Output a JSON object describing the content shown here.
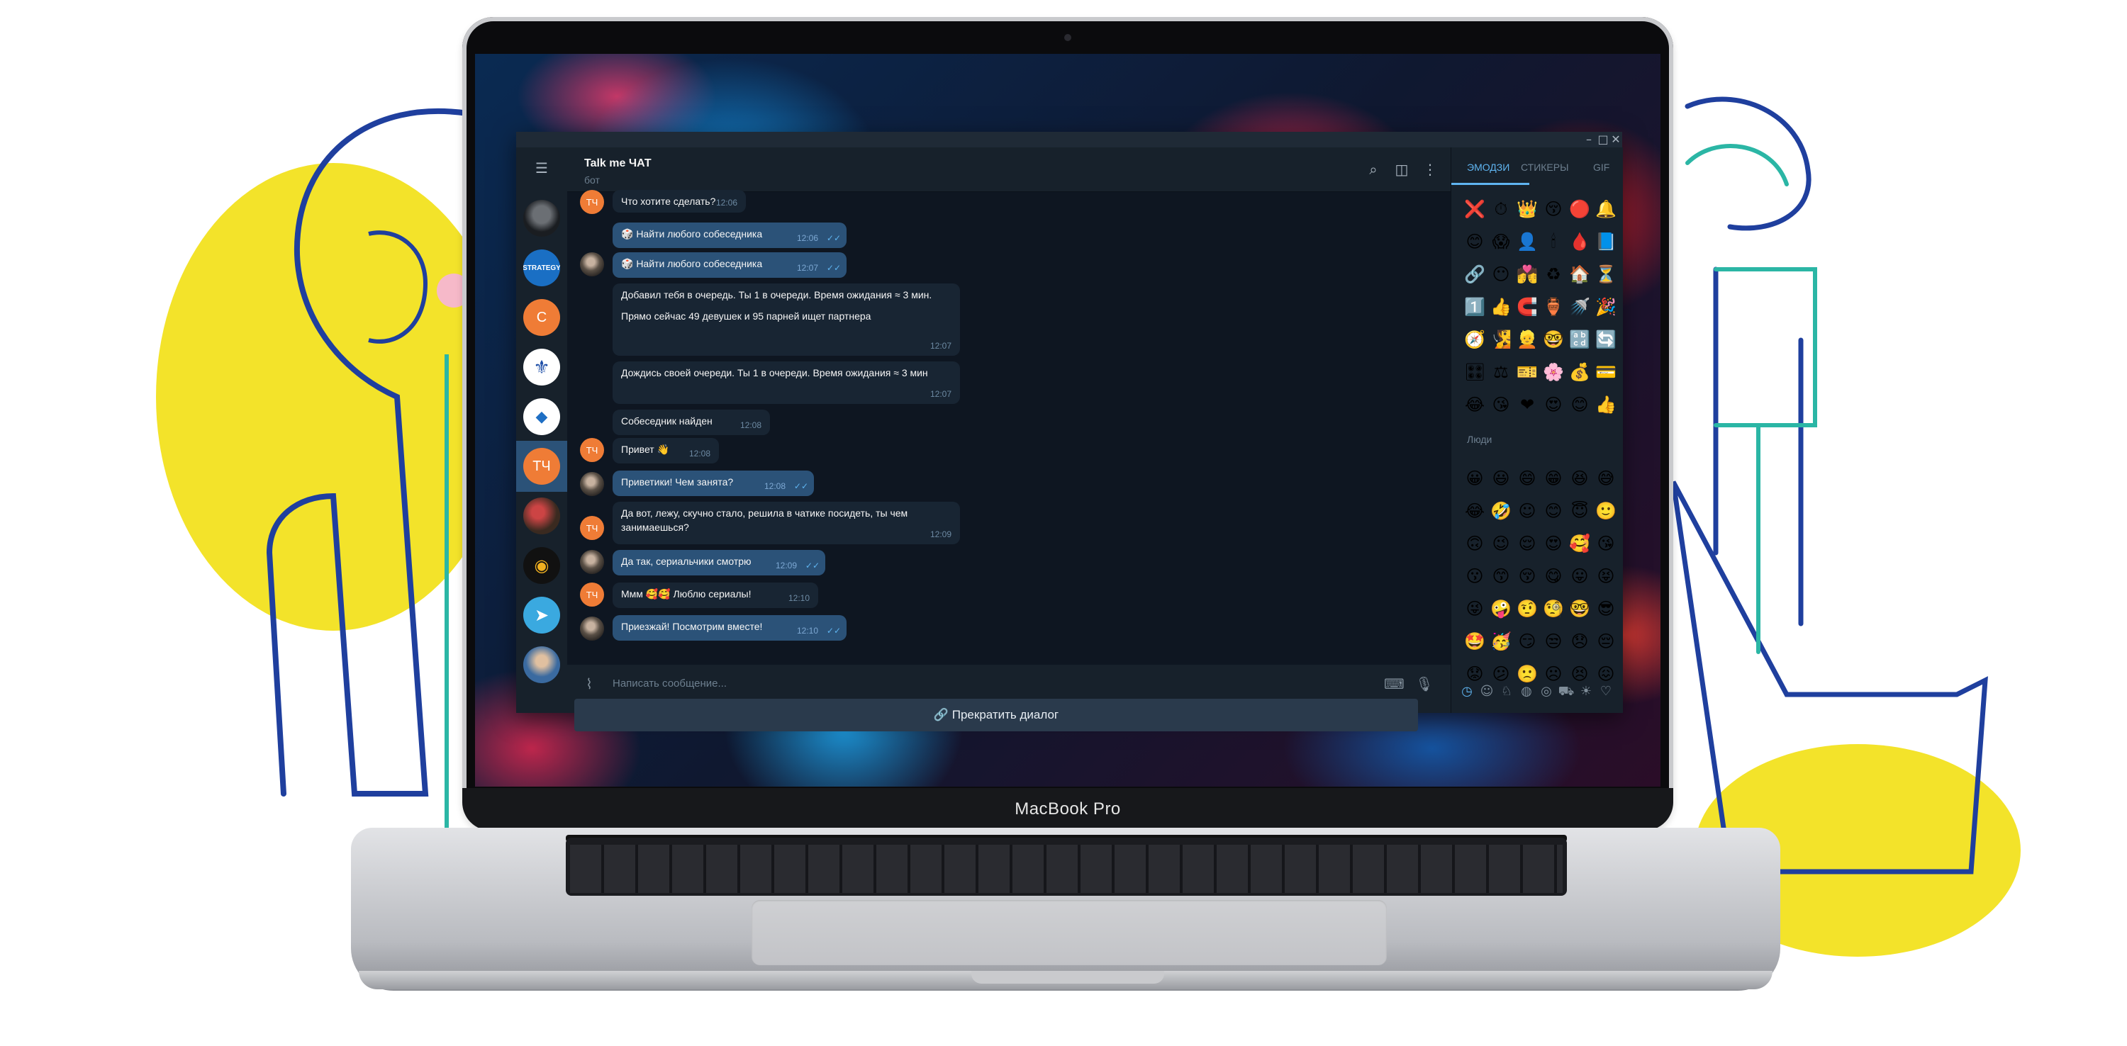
{
  "device": {
    "brand": "MacBook Pro"
  },
  "window": {
    "controls": [
      "minimize",
      "maximize",
      "close"
    ]
  },
  "sidebar": {
    "items": [
      {
        "name": "chat-1",
        "avatar": "photo-dark"
      },
      {
        "name": "chat-strategy",
        "avatar": "STRATEGY"
      },
      {
        "name": "chat-c",
        "initials": "С",
        "color": "#ef7c36"
      },
      {
        "name": "chat-4",
        "avatar": "blue-emblem"
      },
      {
        "name": "chat-5",
        "avatar": "fish-logo"
      },
      {
        "name": "chat-tc",
        "initials": "ТЧ",
        "color": "#ef7c36",
        "active": true
      },
      {
        "name": "chat-7",
        "avatar": "photo-game"
      },
      {
        "name": "chat-8",
        "avatar": "eye-logo"
      },
      {
        "name": "chat-telegram",
        "avatar": "telegram-plane"
      },
      {
        "name": "chat-10",
        "avatar": "photo-person"
      }
    ]
  },
  "chat": {
    "title": "Talk me ЧАТ",
    "subtitle": "бот",
    "messages": [
      {
        "dir": "in",
        "avatar": "ТЧ",
        "text": "Что хотите сделать?",
        "time": "12:06"
      },
      {
        "dir": "out",
        "text": "🎲 Найти любого собеседника",
        "time": "12:06",
        "read": true
      },
      {
        "dir": "out",
        "avatar": "photo",
        "text": "🎲 Найти любого собеседника",
        "time": "12:07",
        "read": true
      },
      {
        "dir": "in",
        "text": "Добавил тебя в очередь. Ты 1 в очереди. Время ожидания ≈ 3 мин.",
        "text2": "Прямо сейчас 49 девушек и 95 парней ищет партнера",
        "time": "12:07"
      },
      {
        "dir": "in",
        "text": "Дождись своей очереди. Ты 1 в очереди. Время ожидания ≈ 3 мин",
        "time": "12:07"
      },
      {
        "dir": "in",
        "text": "Собеседник найден",
        "time": "12:08"
      },
      {
        "dir": "in",
        "avatar": "ТЧ",
        "text": "Привет 👋",
        "time": "12:08"
      },
      {
        "dir": "out",
        "avatar": "photo",
        "text": "Приветики! Чем занята?",
        "time": "12:08",
        "read": true
      },
      {
        "dir": "in",
        "avatar": "ТЧ",
        "text": "Да вот, лежу, скучно стало, решила в чатике посидеть, ты чем занимаешься?",
        "time": "12:09"
      },
      {
        "dir": "out",
        "avatar": "photo",
        "text": "Да так, сериальчики смотрю",
        "time": "12:09",
        "read": true
      },
      {
        "dir": "in",
        "avatar": "ТЧ",
        "text": "Ммм 🥰🥰 Люблю сериалы!",
        "time": "12:10"
      },
      {
        "dir": "out",
        "avatar": "photo",
        "text": "Приезжай! Посмотрим вместе!",
        "time": "12:10",
        "read": true
      }
    ],
    "input_placeholder": "Написать сообщение...",
    "stop_button": "🔗 Прекратить диалог"
  },
  "emoji_panel": {
    "tabs": [
      "ЭМОДЗИ",
      "СТИКЕРЫ",
      "GIF"
    ],
    "active_tab": "ЭМОДЗИ",
    "recent": [
      "❌",
      "⏱",
      "👑",
      "😚",
      "🔴",
      "🔔",
      "😊",
      "😱",
      "👤",
      "🕯",
      "🩸",
      "📘",
      "🔗",
      "😶",
      "💏",
      "♻",
      "🏠",
      "⏳",
      "1️⃣",
      "👍",
      "🧲",
      "🏺",
      "🚿",
      "🎉",
      "🧭",
      "🧏",
      "👱",
      "🤓",
      "🔡",
      "🔄",
      "🎛",
      "⚖",
      "🎫",
      "🌸",
      "💰",
      "💳",
      "😂",
      "😘",
      "❤",
      "😍",
      "😊",
      "👍"
    ],
    "section_label": "Люди",
    "people": [
      "😀",
      "😃",
      "😄",
      "😁",
      "😆",
      "😅",
      "😂",
      "🤣",
      "☺",
      "😊",
      "😇",
      "🙂",
      "🙃",
      "😉",
      "😌",
      "😍",
      "🥰",
      "😘",
      "😗",
      "😙",
      "😚",
      "😋",
      "😛",
      "😝",
      "😜",
      "🤪",
      "🤨",
      "🧐",
      "🤓",
      "😎",
      "🤩",
      "🥳",
      "😏",
      "😒",
      "😞",
      "😔",
      "😟",
      "😕",
      "🙁",
      "☹",
      "😣",
      "😖"
    ],
    "category_icons": [
      "clock-icon",
      "smile-icon",
      "cat-icon",
      "apple-icon",
      "ball-icon",
      "car-icon",
      "bulb-icon",
      "heart-icon"
    ]
  }
}
